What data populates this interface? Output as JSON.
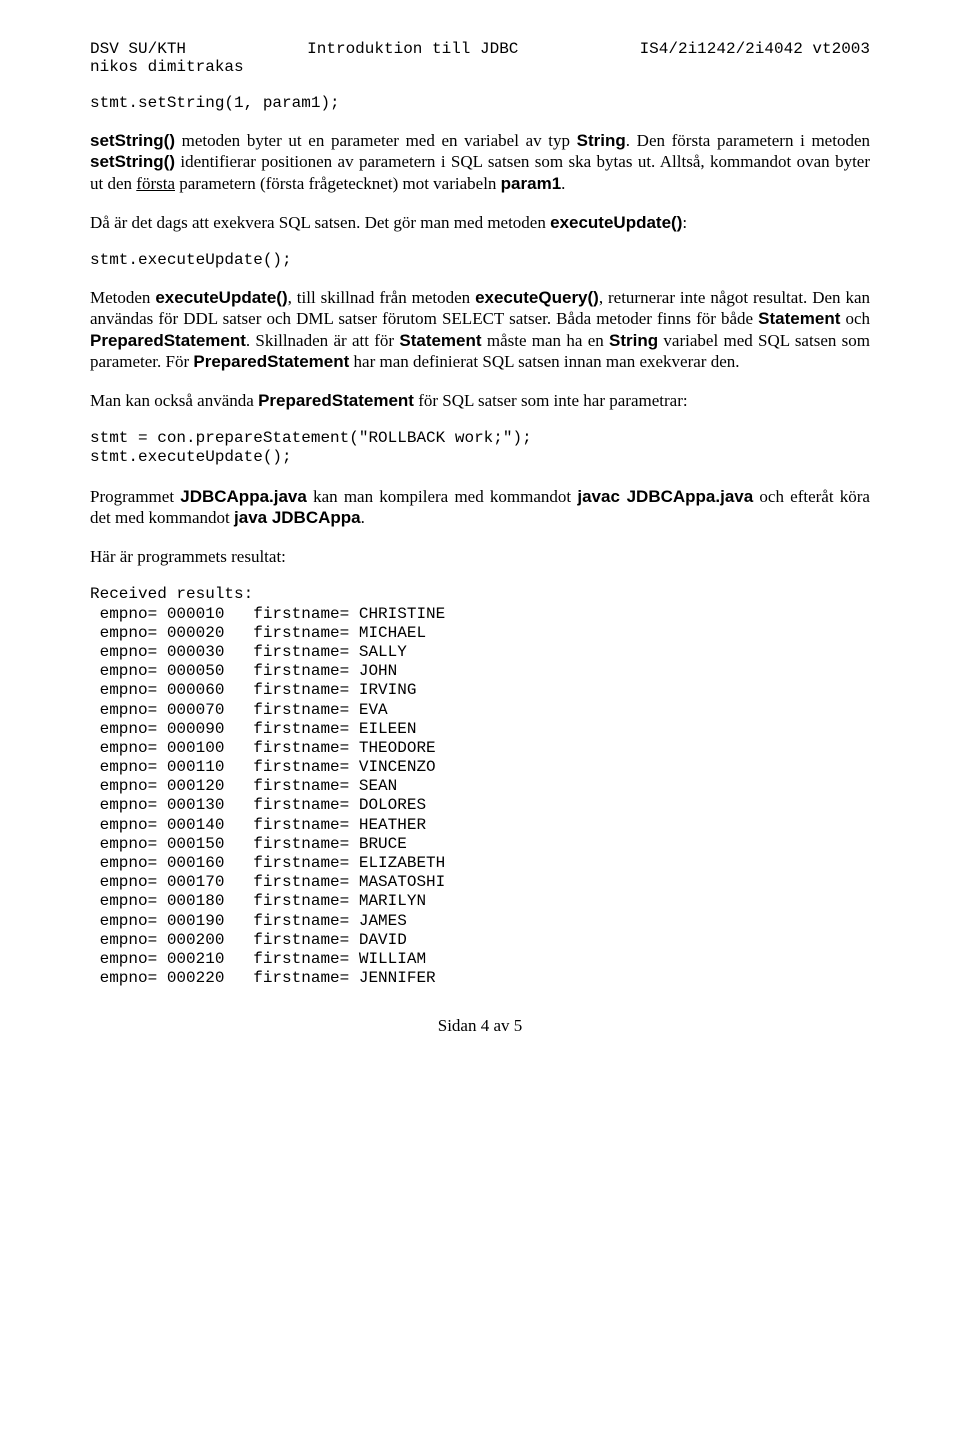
{
  "header": {
    "left": "DSV SU/KTH",
    "center": "Introduktion till JDBC",
    "right": "IS4/2i1242/2i4042 vt2003",
    "sub": "nikos dimitrakas"
  },
  "code1": "stmt.setString(1, param1);",
  "p1_a": "setString()",
  "p1_b": " metoden byter ut en parameter med en variabel av typ ",
  "p1_c": "String",
  "p1_d": ". Den första parametern i metoden ",
  "p1_e": "setString()",
  "p1_f": " identifierar positionen av parametern i SQL satsen som ska bytas ut. Alltså, kommandot ovan byter ut den ",
  "p1_g": "första",
  "p1_h": " parametern (första frågetecknet) mot variabeln ",
  "p1_i": "param1",
  "p1_j": ".",
  "p2_a": "Då är det dags att exekvera SQL satsen. Det gör man med metoden ",
  "p2_b": "executeUpdate()",
  "p2_c": ":",
  "code2": "stmt.executeUpdate();",
  "p3_a": "Metoden ",
  "p3_b": "executeUpdate()",
  "p3_c": ", till skillnad från metoden ",
  "p3_d": "executeQuery()",
  "p3_e": ", returnerar inte något resultat. Den kan användas för DDL satser och DML satser förutom SELECT satser. Båda metoder finns för både ",
  "p3_f": "Statement",
  "p3_g": " och ",
  "p3_h": "PreparedStatement",
  "p3_i": ". Skillnaden är att för ",
  "p3_j": "Statement",
  "p3_k": " måste man ha en ",
  "p3_l": "String",
  "p3_m": " variabel med SQL satsen som parameter. För ",
  "p3_n": "PreparedStatement",
  "p3_o": " har man definierat SQL satsen innan man exekverar den.",
  "p4_a": "Man kan också använda ",
  "p4_b": "PreparedStatement",
  "p4_c": " för SQL satser som inte har parametrar:",
  "code3": "stmt = con.prepareStatement(\"ROLLBACK work;\");\nstmt.executeUpdate();",
  "p5_a": "Programmet ",
  "p5_b": "JDBCAppa.java",
  "p5_c": " kan man kompilera med kommandot ",
  "p5_d": "javac JDBCAppa.java",
  "p5_e": " och efteråt köra det med kommandot ",
  "p5_f": "java JDBCAppa",
  "p5_g": ".",
  "p6": "Här är programmets resultat:",
  "results_header": "Received results:",
  "results": [
    {
      "empno": "000010",
      "firstname": "CHRISTINE"
    },
    {
      "empno": "000020",
      "firstname": "MICHAEL"
    },
    {
      "empno": "000030",
      "firstname": "SALLY"
    },
    {
      "empno": "000050",
      "firstname": "JOHN"
    },
    {
      "empno": "000060",
      "firstname": "IRVING"
    },
    {
      "empno": "000070",
      "firstname": "EVA"
    },
    {
      "empno": "000090",
      "firstname": "EILEEN"
    },
    {
      "empno": "000100",
      "firstname": "THEODORE"
    },
    {
      "empno": "000110",
      "firstname": "VINCENZO"
    },
    {
      "empno": "000120",
      "firstname": "SEAN"
    },
    {
      "empno": "000130",
      "firstname": "DOLORES"
    },
    {
      "empno": "000140",
      "firstname": "HEATHER"
    },
    {
      "empno": "000150",
      "firstname": "BRUCE"
    },
    {
      "empno": "000160",
      "firstname": "ELIZABETH"
    },
    {
      "empno": "000170",
      "firstname": "MASATOSHI"
    },
    {
      "empno": "000180",
      "firstname": "MARILYN"
    },
    {
      "empno": "000190",
      "firstname": "JAMES"
    },
    {
      "empno": "000200",
      "firstname": "DAVID"
    },
    {
      "empno": "000210",
      "firstname": "WILLIAM"
    },
    {
      "empno": "000220",
      "firstname": "JENNIFER"
    }
  ],
  "row_prefix_empno": " empno= ",
  "row_fn_label": "firstname= ",
  "footer": "Sidan 4 av 5"
}
